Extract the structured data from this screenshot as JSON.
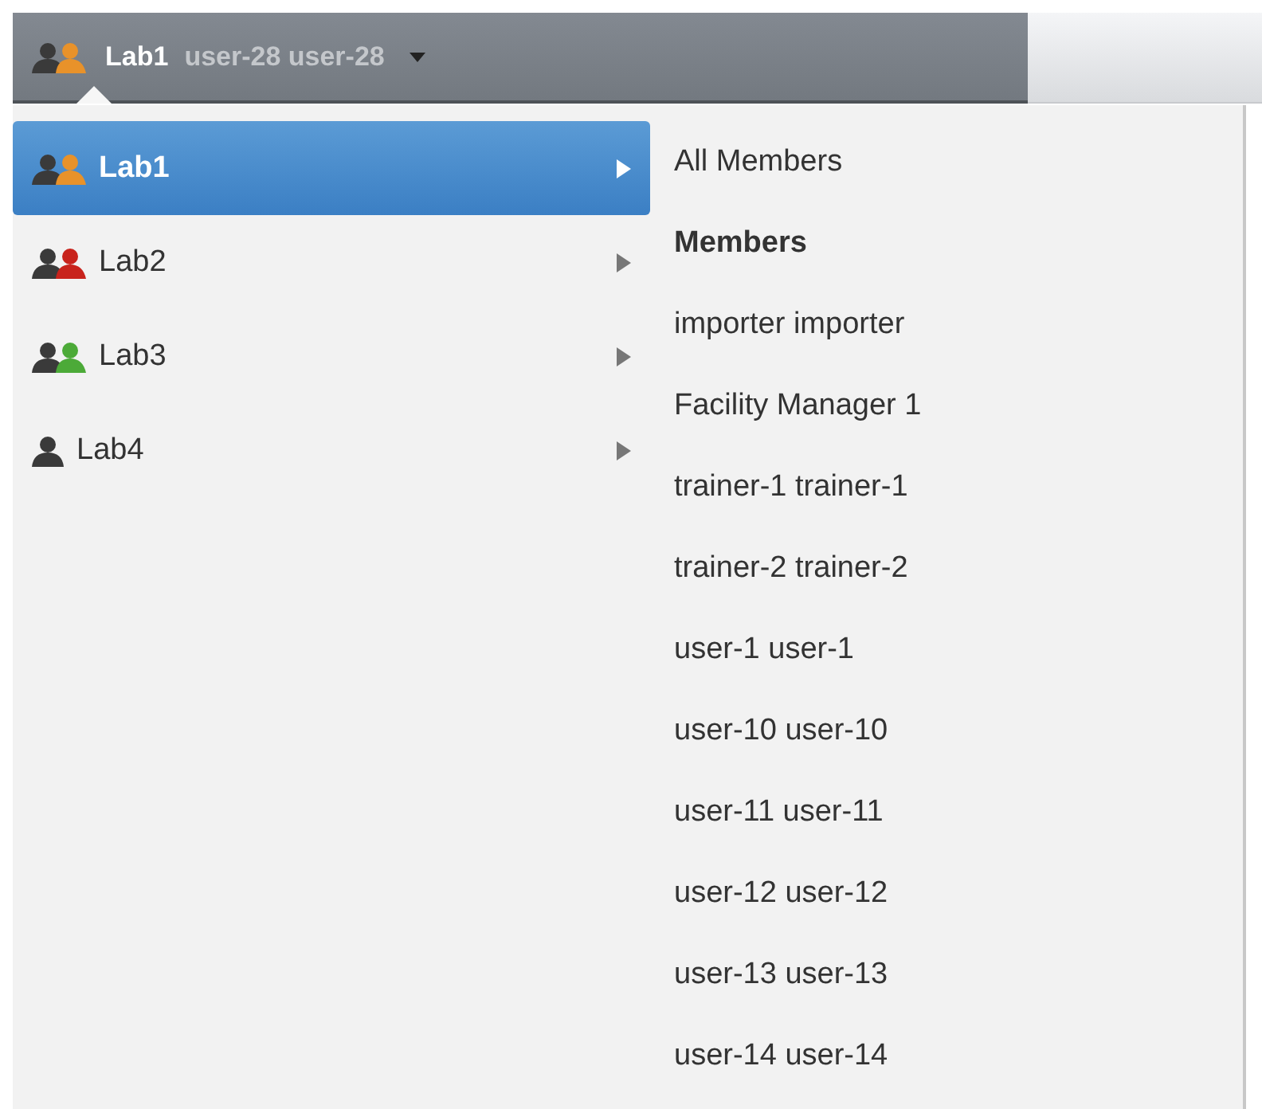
{
  "topbar": {
    "group": {
      "label": "Lab1",
      "color": "#e8922a"
    },
    "user": "user-28 user-28"
  },
  "groups": [
    {
      "label": "Lab1",
      "color": "#e8922a",
      "selected": true
    },
    {
      "label": "Lab2",
      "color": "#c8231c",
      "selected": false
    },
    {
      "label": "Lab3",
      "color": "#4caa38",
      "selected": false
    },
    {
      "label": "Lab4",
      "selected": false
    }
  ],
  "members": [
    {
      "kind": "link",
      "label": "All Members"
    },
    {
      "kind": "header",
      "label": "Members"
    },
    {
      "kind": "link",
      "label": "importer importer"
    },
    {
      "kind": "link",
      "label": "Facility Manager 1"
    },
    {
      "kind": "link",
      "label": "trainer-1 trainer-1"
    },
    {
      "kind": "link",
      "label": "trainer-2 trainer-2"
    },
    {
      "kind": "link",
      "label": "user-1 user-1"
    },
    {
      "kind": "link",
      "label": "user-10 user-10"
    },
    {
      "kind": "link",
      "label": "user-11 user-11"
    },
    {
      "kind": "link",
      "label": "user-12 user-12"
    },
    {
      "kind": "link",
      "label": "user-13 user-13"
    },
    {
      "kind": "link",
      "label": "user-14 user-14"
    }
  ]
}
